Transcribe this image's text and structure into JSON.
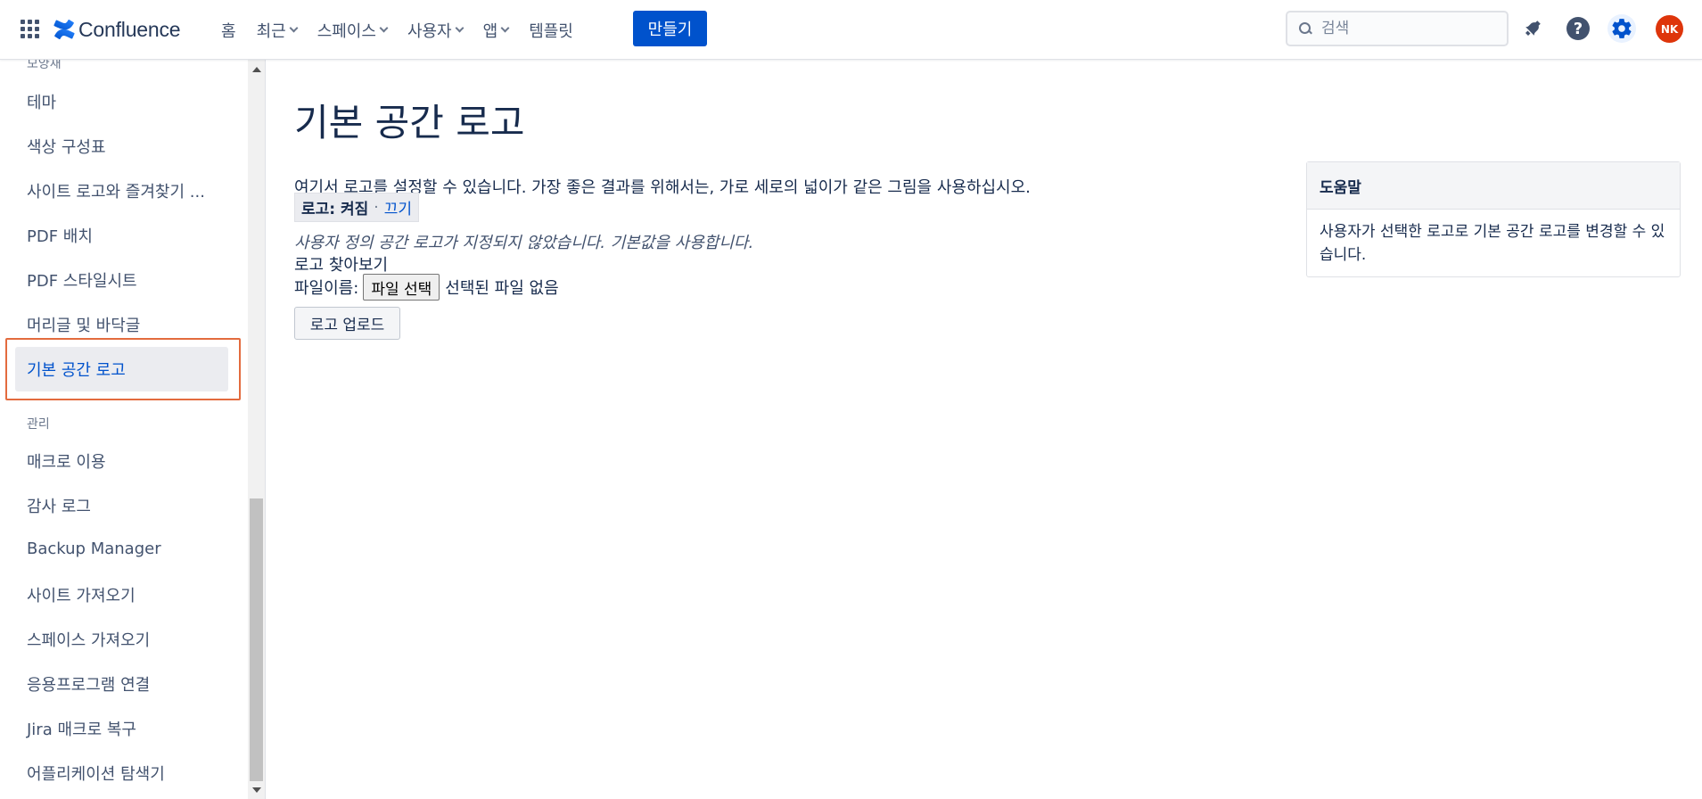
{
  "app": {
    "name": "Confluence"
  },
  "topnav": {
    "items": [
      {
        "label": "홈",
        "dropdown": false
      },
      {
        "label": "최근",
        "dropdown": true
      },
      {
        "label": "스페이스",
        "dropdown": true
      },
      {
        "label": "사용자",
        "dropdown": true
      },
      {
        "label": "앱",
        "dropdown": true
      },
      {
        "label": "템플릿",
        "dropdown": false
      }
    ],
    "create_label": "만들기",
    "search_placeholder": "검색",
    "avatar_initials": "NK",
    "icons": [
      "app-switcher-icon",
      "search-icon",
      "notification-icon",
      "help-icon",
      "settings-icon"
    ],
    "colors": {
      "accent": "#0052cc",
      "avatar": "#de350b"
    }
  },
  "sidebar": {
    "section_top": "모양새",
    "items": [
      "테마",
      "색상 구성표",
      "사이트 로고와 즐겨찾기 ...",
      "PDF 배치",
      "PDF 스타일시트",
      "머리글 및 바닥글"
    ],
    "active_item": "기본 공간 로고",
    "section_admin": "관리",
    "admin_items": [
      "매크로 이용",
      "감사 로그",
      "Backup Manager",
      "사이트 가져오기",
      "스페이스 가져오기",
      "응용프로그램 연결",
      "Jira 매크로 복구",
      "어플리케이션 탐색기"
    ]
  },
  "main": {
    "title": "기본 공간 로고",
    "description": "여기서 로고를 설정할 수 있습니다. 가장 좋은 결과를 위해서는, 가로 세로의 넓이가 같은 그림을 사용하십시오.",
    "toggle_state": "로고: 켜짐",
    "toggle_separator": "·",
    "toggle_off_link": "끄기",
    "notice": "사용자 정의 공간 로고가 지정되지 않았습니다. 기본값을 사용합니다.",
    "browse_label": "로고 찾아보기",
    "filename_label": "파일이름:",
    "file_button": "파일 선택",
    "file_status": "선택된 파일 없음",
    "upload_button": "로고 업로드"
  },
  "help_panel": {
    "title": "도움말",
    "body": "사용자가 선택한 로고로 기본 공간 로고를 변경할 수 있습니다."
  }
}
